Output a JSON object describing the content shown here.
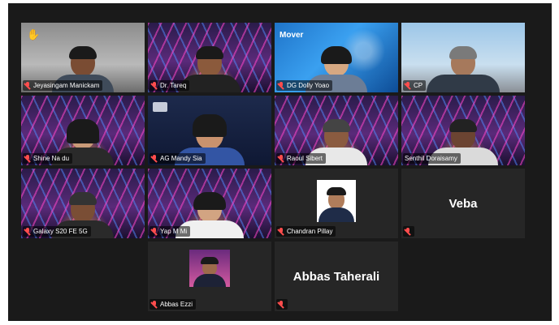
{
  "participants": [
    {
      "name": "Jeyasingam Manickam",
      "raised_hand": true
    },
    {
      "name": "Dr. Tareq"
    },
    {
      "name": "DG Dolly Yoao",
      "overlay": "Mover"
    },
    {
      "name": "CP"
    },
    {
      "name": "Shine Na...",
      "name_visible": "Shine Na du"
    },
    {
      "name": "AG Mandy Sia"
    },
    {
      "name": "Raoul Sibert"
    },
    {
      "name": "Senthil Doraisamy"
    },
    {
      "name": "Galaxy S20 FE 5G"
    },
    {
      "name": "Yap M Mi"
    },
    {
      "name": "Chandran Pillay"
    },
    {
      "name": "",
      "big_name": "Veba"
    },
    {
      "name": "Abbas Ezzi"
    },
    {
      "name": "",
      "big_name": "Abbas Taherali"
    }
  ],
  "colors": {
    "active_speaker_border": "#e3e08a",
    "muted_mic": "#ff4d4d",
    "raised_hand": "#f2c230"
  },
  "icons": {
    "muted": "mic-muted-icon",
    "hand": "raised-hand-icon"
  }
}
